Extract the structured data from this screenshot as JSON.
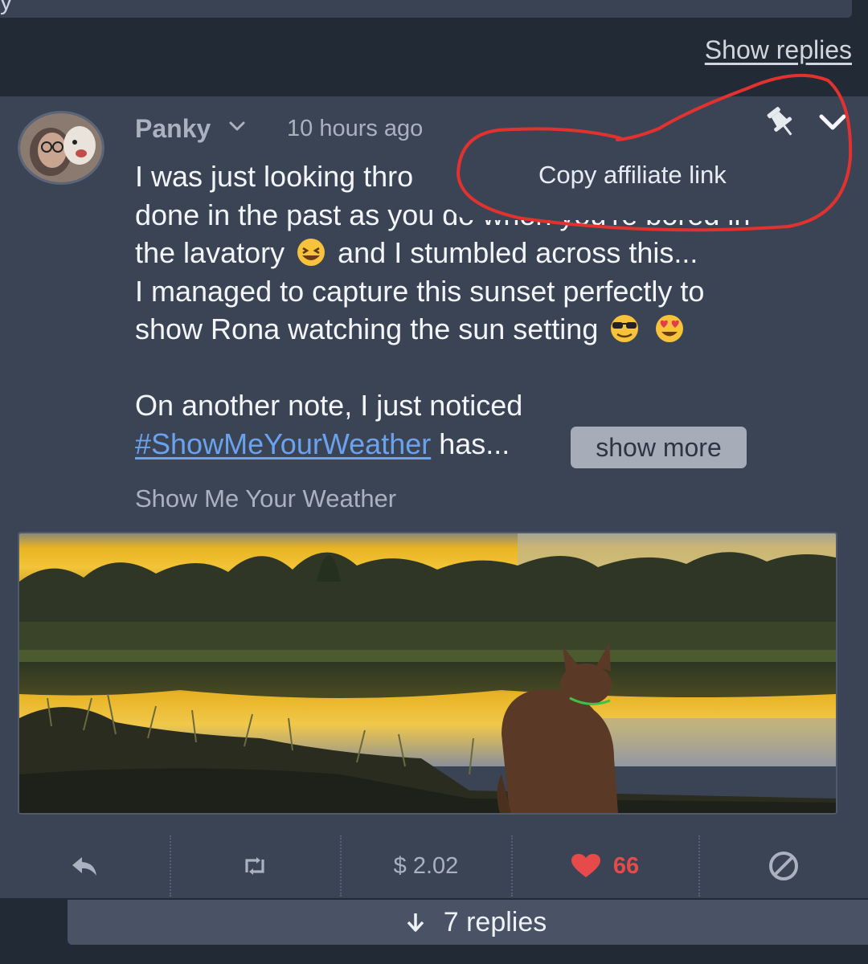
{
  "previous_post": {
    "text_fragment": "y",
    "show_replies_label": "Show replies"
  },
  "post": {
    "author": "Panky",
    "timestamp": "10 hours ago",
    "body_lines": [
      "I was just looking thro",
      "done in the past as you do when you're bored in",
      "the lavatory",
      "and I stumbled across this...",
      "I managed to capture this sunset perfectly to",
      "show Rona watching the sun setting",
      "On another note, I just noticed",
      "has..."
    ],
    "hashtag": "#ShowMeYourWeather",
    "show_more_label": "show more",
    "community": "Show Me Your Weather",
    "image_alt": "Sunset over a lake with a dog watching"
  },
  "popup_menu": {
    "item_label": "Copy affiliate link"
  },
  "actions": {
    "payout": "$ 2.02",
    "likes": "66"
  },
  "replies": {
    "label": "7 replies"
  },
  "icons": {
    "reply": "reply-icon",
    "resteem": "resteem-icon",
    "like": "heart-icon",
    "flag": "flag-icon",
    "pin": "pin-icon",
    "menu": "chevron-down-icon"
  },
  "colors": {
    "card_background": "#3b4455",
    "page_background": "#222a36",
    "hashtag": "#6aa2ee",
    "like": "#e74a4a",
    "annotation": "#e2322f"
  }
}
